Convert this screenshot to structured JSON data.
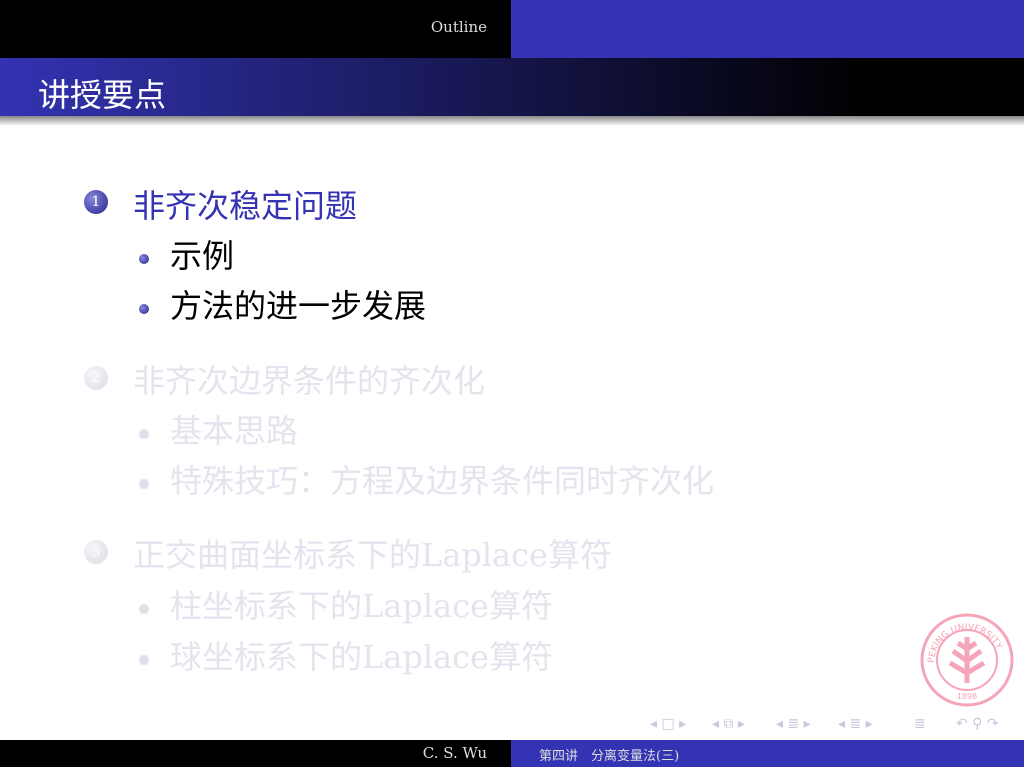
{
  "header": {
    "section": "Outline"
  },
  "frame": {
    "title": "讲授要点"
  },
  "outline": [
    {
      "number": "1",
      "title": "非齐次稳定问题",
      "state": "active",
      "items": [
        "示例",
        "方法的进一步发展"
      ]
    },
    {
      "number": "2",
      "title": "非齐次边界条件的齐次化",
      "state": "faded",
      "items": [
        "基本思路",
        "特殊技巧：方程及边界条件同时齐次化"
      ]
    },
    {
      "number": "3",
      "title": "正交曲面坐标系下的Laplace算符",
      "state": "faded",
      "items": [
        "柱坐标系下的Laplace算符",
        "球坐标系下的Laplace算符"
      ]
    }
  ],
  "logo": {
    "text": "PEKING UNIVERSITY",
    "year": "1898"
  },
  "nav": {
    "frame": "◂ □ ▸",
    "subsection": "◂ ⧉ ▸",
    "section": "◂ ≣ ▸",
    "subsec2": "◂ ≣ ▸",
    "toc": "≣",
    "controls": "↶ ⚲ ↷"
  },
  "footer": {
    "author": "C. S. Wu",
    "lecture": "第四讲　分离变量法(三)"
  },
  "colors": {
    "accent": "#3333b3",
    "faded": "#e4e4ee"
  }
}
